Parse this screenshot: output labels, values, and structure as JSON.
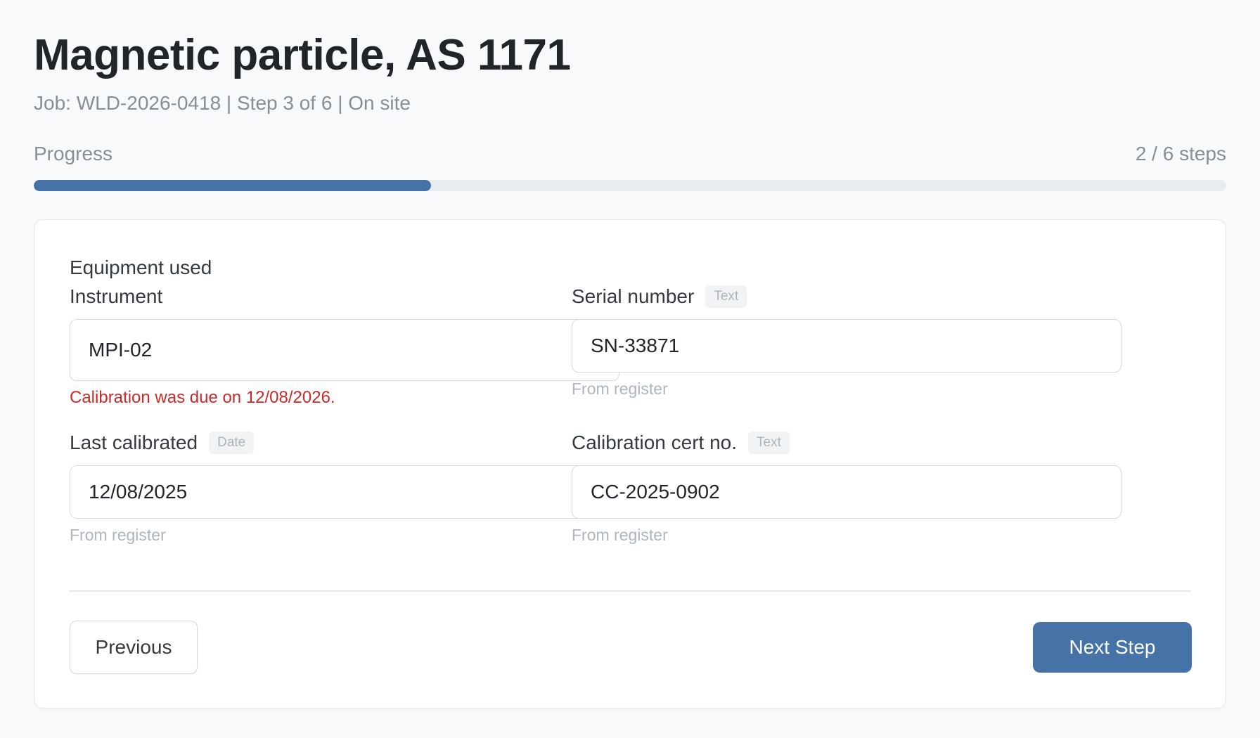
{
  "header": {
    "title": "Magnetic particle, AS 1171",
    "subtitle": "Job: WLD-2026-0418 | Step 3 of 6 | On site"
  },
  "progress": {
    "label": "Progress",
    "count_label": "2 / 6 steps",
    "completed": 2,
    "total": 6
  },
  "section": {
    "title": "Equipment used"
  },
  "fields": {
    "instrument": {
      "label": "Instrument",
      "value": "MPI-02",
      "error": "Calibration was due on 12/08/2026.",
      "icon": "chevron-down-icon"
    },
    "serial_number": {
      "label": "Serial number",
      "badge": "Text",
      "value": "SN-33871",
      "helper": "From register"
    },
    "last_calibrated": {
      "label": "Last calibrated",
      "badge": "Date",
      "value": "12/08/2025",
      "helper": "From register"
    },
    "calibration_cert": {
      "label": "Calibration cert no.",
      "badge": "Text",
      "value": "CC-2025-0902",
      "helper": "From register"
    }
  },
  "actions": {
    "previous_label": "Previous",
    "next_label": "Next Step"
  },
  "colors": {
    "accent": "#4573a8",
    "error": "#c92a2a",
    "muted": "#868e96"
  }
}
